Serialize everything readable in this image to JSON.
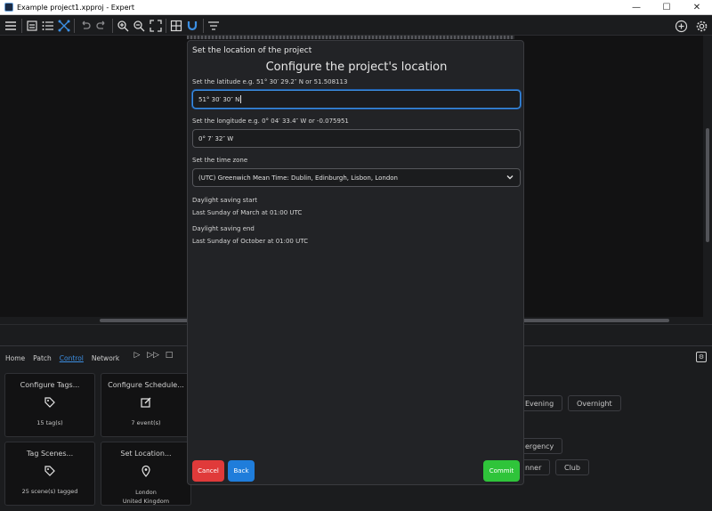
{
  "window": {
    "title": "Example project1.xpproj - Expert",
    "controls": [
      "—",
      "☐",
      "✕"
    ]
  },
  "toolbar": {
    "icons": [
      "menu-icon",
      "open-project-icon",
      "list-icon",
      "network-icon",
      "undo-icon",
      "redo-icon",
      "zoom-in-icon",
      "zoom-out-icon",
      "fit-icon",
      "grid-icon",
      "magnet-icon",
      "filter-icon",
      "add-icon",
      "settings-icon"
    ]
  },
  "bottom": {
    "tabs": [
      "Home",
      "Patch",
      "Control",
      "Network"
    ],
    "active_tab": "Control",
    "cards": [
      {
        "title": "Configure Tags...",
        "icon": "tag-settings-icon",
        "sub": "15 tag(s)"
      },
      {
        "title": "Configure Schedule...",
        "icon": "edit-icon",
        "sub": "7 event(s)"
      },
      {
        "title": "Tag Scenes...",
        "icon": "tag-icon",
        "sub": "25 scene(s) tagged"
      },
      {
        "title": "Set Location...",
        "icon": "location-pin-icon",
        "sub": "London",
        "sub2": "United Kingdom"
      }
    ],
    "chips": [
      "Evening",
      "Overnight",
      "ergency",
      "nner",
      "Club"
    ]
  },
  "modal": {
    "title": "Set the location of the project",
    "heading": "Configure the project's location",
    "latitude_label": "Set the latitude e.g. 51° 30′ 29.2″ N or 51.508113",
    "latitude_value": "51° 30′ 30″ N",
    "longitude_label": "Set the longitude e.g. 0° 04′ 33.4″ W or -0.075951",
    "longitude_value": "0° 7′ 32″ W",
    "timezone_label": "Set the time zone",
    "timezone_value": "(UTC) Greenwich Mean Time: Dublin, Edinburgh, Lisbon, London",
    "dst_start_label": "Daylight saving start",
    "dst_start_value": "Last Sunday of March at 01:00 UTC",
    "dst_end_label": "Daylight saving end",
    "dst_end_value": "Last Sunday of October at 01:00 UTC",
    "cancel_label": "Cancel",
    "back_label": "Back",
    "commit_label": "Commit"
  },
  "colors": {
    "accent": "#3c8fe3",
    "cancel": "#e03a3a",
    "back": "#1f7ddb",
    "commit": "#2fc43a"
  }
}
